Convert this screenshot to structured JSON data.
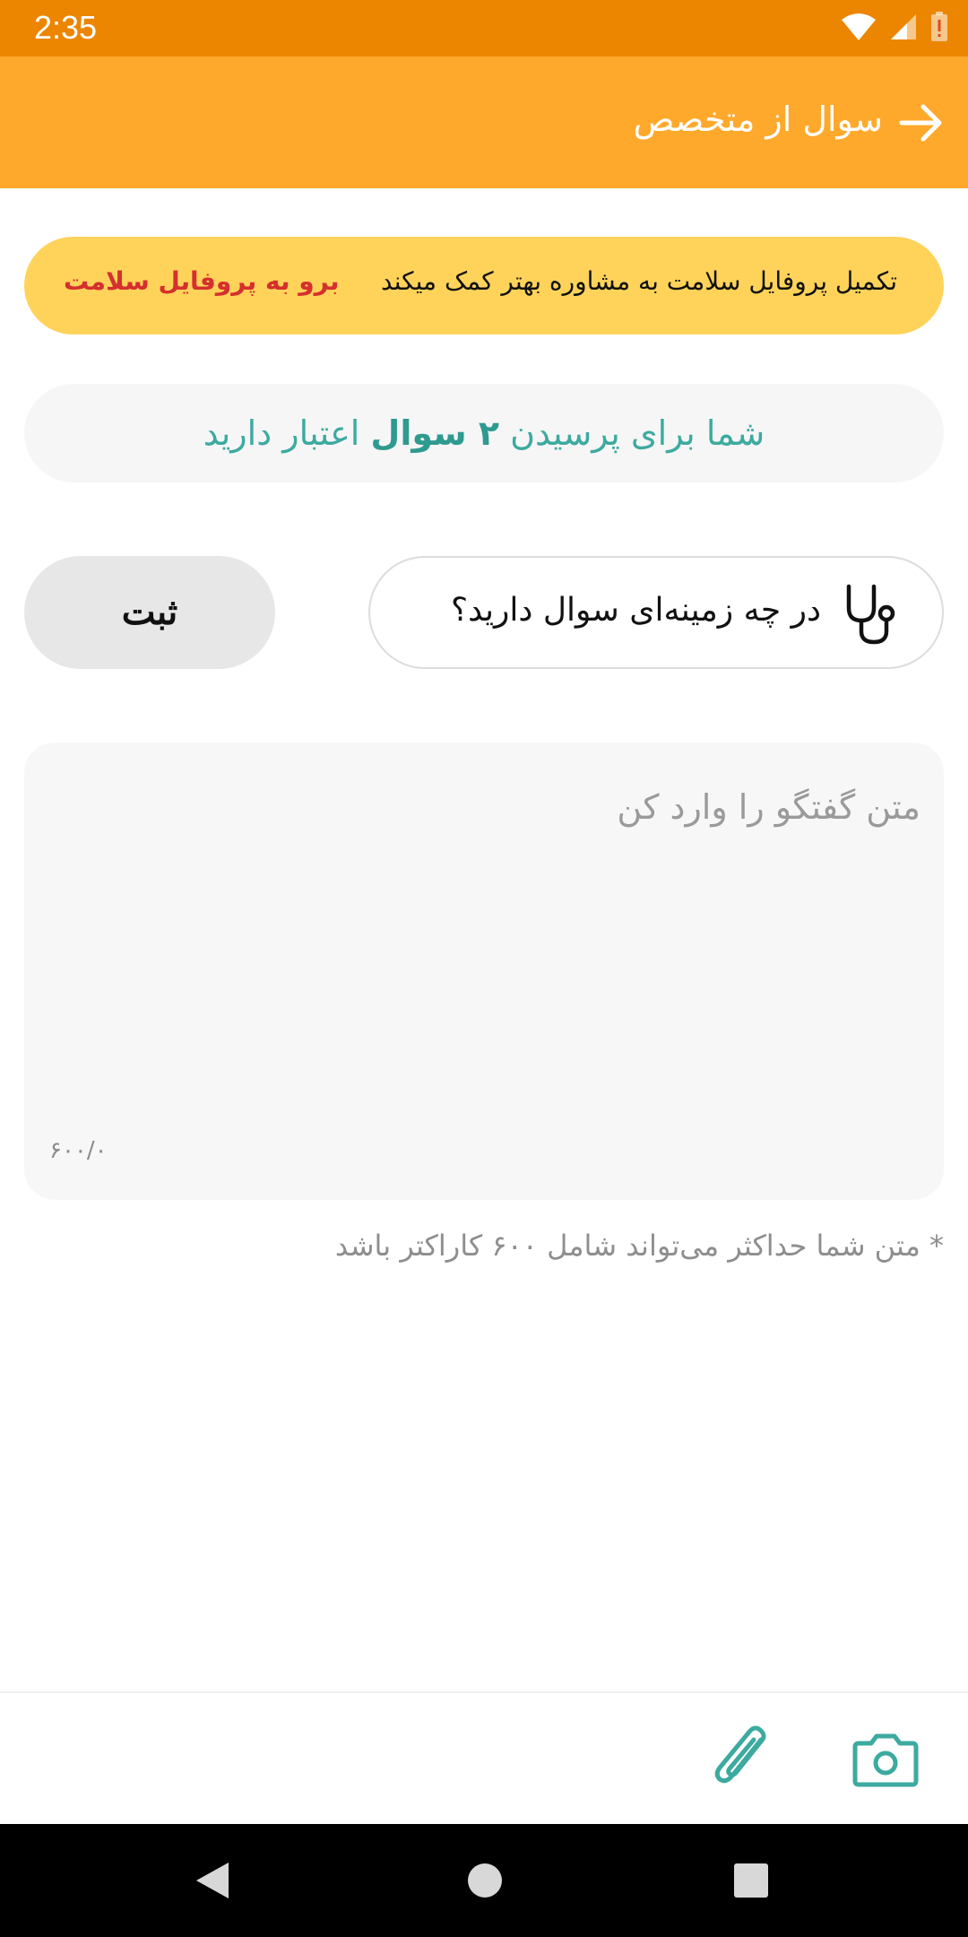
{
  "status_bar": {
    "time": "2:35"
  },
  "app_bar": {
    "title": "سوال از متخصص"
  },
  "profile_banner": {
    "text": "تکمیل پروفایل سلامت به مشاوره بهتر کمک میکند",
    "link": "برو به پروفایل سلامت"
  },
  "credit": {
    "prefix": "شما برای پرسیدن",
    "count": "۲ سوال",
    "suffix": "اعتبار دارید"
  },
  "topic": {
    "label": "در چه زمینه‌ای سوال دارید؟"
  },
  "submit": {
    "label": "ثبت"
  },
  "message": {
    "placeholder": "متن گفتگو را وارد کن",
    "counter": "۶۰۰/۰"
  },
  "hint": "* متن شما حداکثر می‌تواند شامل ۶۰۰ کاراکتر باشد",
  "colors": {
    "status_bar": "#ec8500",
    "app_bar": "#ffa92c",
    "banner": "#ffd35a",
    "link": "#d52f2f",
    "teal": "#3daaa0"
  },
  "icons": {
    "back": "arrow-right-icon",
    "topic": "stethoscope-icon",
    "attach": "paperclip-icon",
    "camera": "camera-icon"
  }
}
